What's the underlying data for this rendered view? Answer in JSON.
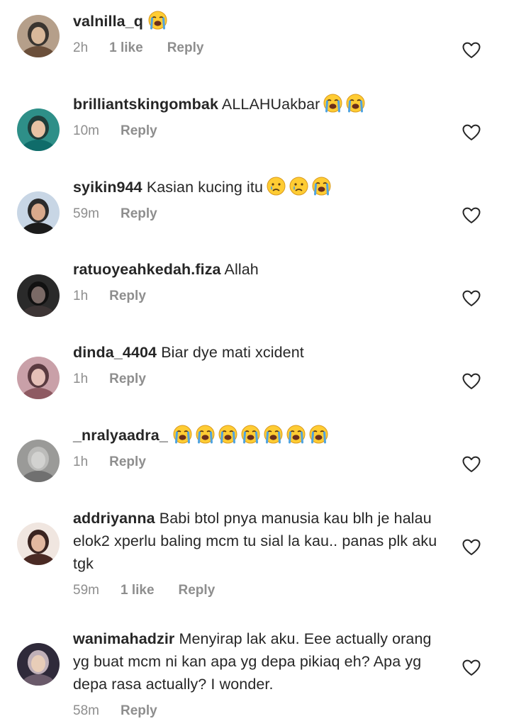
{
  "icons": {
    "like": "heart-outline-icon",
    "loudly_crying": "loudly-crying-face-emoji",
    "crying": "crying-face-emoji"
  },
  "colors": {
    "text": "#262626",
    "secondary": "#8e8e8e",
    "emoji_face": "#ffcc33",
    "emoji_tears": "#4fa3e0"
  },
  "comments": [
    {
      "username": "valnilla_q",
      "text": "",
      "emoji": [
        "loudly_crying"
      ],
      "time": "2h",
      "likes": "1 like",
      "reply": "Reply"
    },
    {
      "username": "brilliantskingombak",
      "text": "ALLAHUakbar",
      "emoji": [
        "loudly_crying",
        "loudly_crying"
      ],
      "time": "10m",
      "likes": "",
      "reply": "Reply"
    },
    {
      "username": "syikin944",
      "text": "Kasian kucing itu",
      "emoji": [
        "crying",
        "crying",
        "loudly_crying"
      ],
      "time": "59m",
      "likes": "",
      "reply": "Reply"
    },
    {
      "username": "ratuoyeahkedah.fiza",
      "text": "Allah",
      "emoji": [],
      "time": "1h",
      "likes": "",
      "reply": "Reply"
    },
    {
      "username": "dinda_4404",
      "text": "Biar dye mati xcident",
      "emoji": [],
      "time": "1h",
      "likes": "",
      "reply": "Reply"
    },
    {
      "username": "_nralyaadra_",
      "text": "",
      "emoji": [
        "loudly_crying",
        "loudly_crying",
        "loudly_crying",
        "loudly_crying",
        "loudly_crying",
        "loudly_crying",
        "loudly_crying"
      ],
      "time": "1h",
      "likes": "",
      "reply": "Reply"
    },
    {
      "username": "addriyanna",
      "text": "Babi btol pnya manusia kau blh je halau elok2 xperlu baling mcm tu sial la kau.. panas plk aku tgk",
      "emoji": [],
      "time": "59m",
      "likes": "1 like",
      "reply": "Reply"
    },
    {
      "username": "wanimahadzir",
      "text": "Menyirap lak aku. Eee actually orang yg buat mcm ni kan apa yg depa pikiaq eh? Apa yg depa rasa actually? I wonder.",
      "emoji": [],
      "time": "58m",
      "likes": "",
      "reply": "Reply"
    }
  ]
}
